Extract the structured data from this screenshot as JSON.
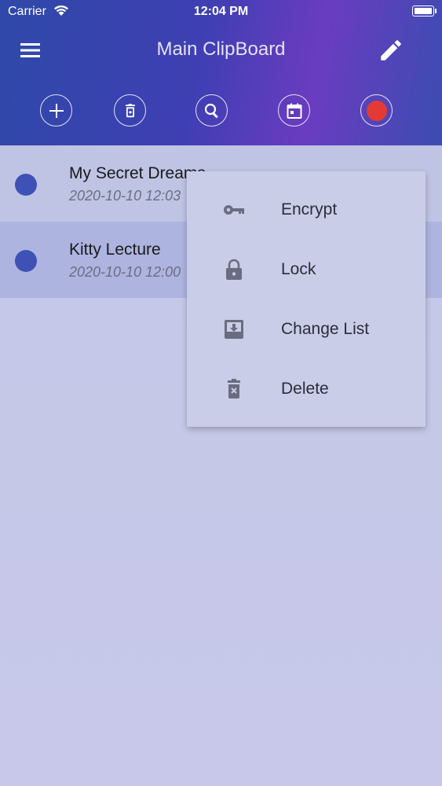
{
  "status_bar": {
    "carrier": "Carrier",
    "time": "12:04 PM"
  },
  "header": {
    "title": "Main ClipBoard"
  },
  "toolbar": {
    "icons": [
      "plus-icon",
      "delete-icon",
      "search-icon",
      "calendar-icon",
      "record-icon"
    ],
    "record_color": "#e53935"
  },
  "list": {
    "items": [
      {
        "title": "My Secret Dreams",
        "date": "2020-10-10 12:03"
      },
      {
        "title": "Kitty Lecture",
        "date": "2020-10-10 12:00"
      }
    ],
    "dot_color": "#3f51b5"
  },
  "context_menu": {
    "items": [
      {
        "label": "Encrypt",
        "icon": "key-icon"
      },
      {
        "label": "Lock",
        "icon": "lock-icon"
      },
      {
        "label": "Change List",
        "icon": "move-to-inbox-icon"
      },
      {
        "label": "Delete",
        "icon": "trash-icon"
      }
    ]
  }
}
